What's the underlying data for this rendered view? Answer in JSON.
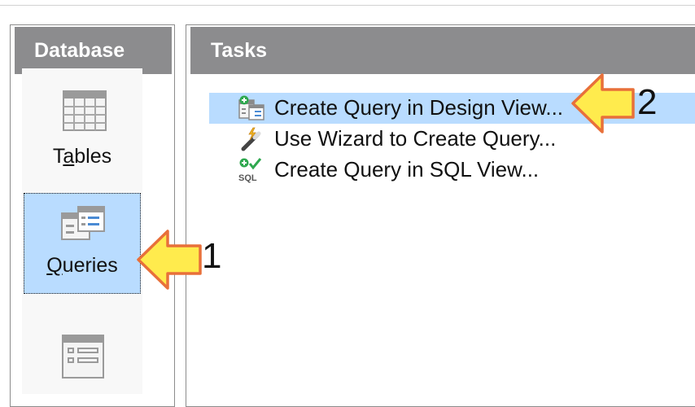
{
  "database_panel": {
    "title": "Database",
    "items": [
      {
        "label_pre": "T",
        "label_u": "a",
        "label_post": "bles"
      },
      {
        "label_pre": "",
        "label_u": "Q",
        "label_post": "ueries",
        "selected": true
      },
      {
        "label_pre": "",
        "label_u": "",
        "label_post": ""
      }
    ]
  },
  "tasks_panel": {
    "title": "Tasks",
    "tasks": [
      {
        "label": "Create Query in Design View...",
        "icon": "design-view-icon",
        "selected": true
      },
      {
        "label": "Use Wizard to Create Query...",
        "icon": "wizard-wand-icon"
      },
      {
        "label": "Create Query in SQL View...",
        "icon": "sql-view-icon",
        "icon_text": "SQL"
      }
    ]
  },
  "annotations": {
    "callout_1": "1",
    "callout_2": "2"
  },
  "colors": {
    "header_bg": "#8c8c8e",
    "selection_bg": "#b9dcff",
    "arrow_fill": "#ffeb4d",
    "arrow_stroke": "#e8703a"
  }
}
